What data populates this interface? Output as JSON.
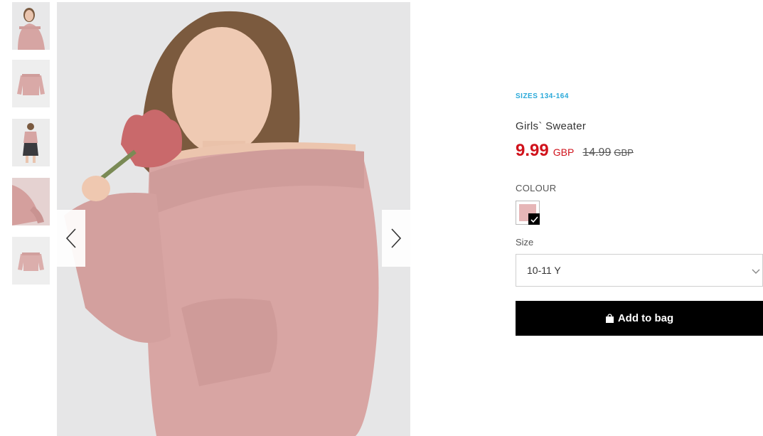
{
  "gallery": {
    "thumbnails": [
      {
        "name": "thumbnail-model-front",
        "active": true
      },
      {
        "name": "thumbnail-sweater-flat",
        "active": false
      },
      {
        "name": "thumbnail-model-full",
        "active": false
      },
      {
        "name": "thumbnail-sleeve-detail",
        "active": false
      },
      {
        "name": "thumbnail-sweater-back",
        "active": false
      }
    ],
    "prev_icon": "chevron-left-icon",
    "next_icon": "chevron-right-icon"
  },
  "product": {
    "sizes_badge": "SIZES 134-164",
    "title": "Girls` Sweater",
    "price_now": "9.99",
    "price_now_currency": "GBP",
    "price_old": "14.99",
    "price_old_currency": "GBP",
    "colour_label": "COLOUR",
    "colour_selected": "#e6b6b7",
    "size_label": "Size",
    "size_value": "10-11 Y",
    "add_to_bag_label": "Add to bag"
  },
  "colors": {
    "accent_blue": "#2aa9d9",
    "sale_red": "#d0121b",
    "button_black": "#000000",
    "sweater_pink": "#d9a7a5"
  }
}
